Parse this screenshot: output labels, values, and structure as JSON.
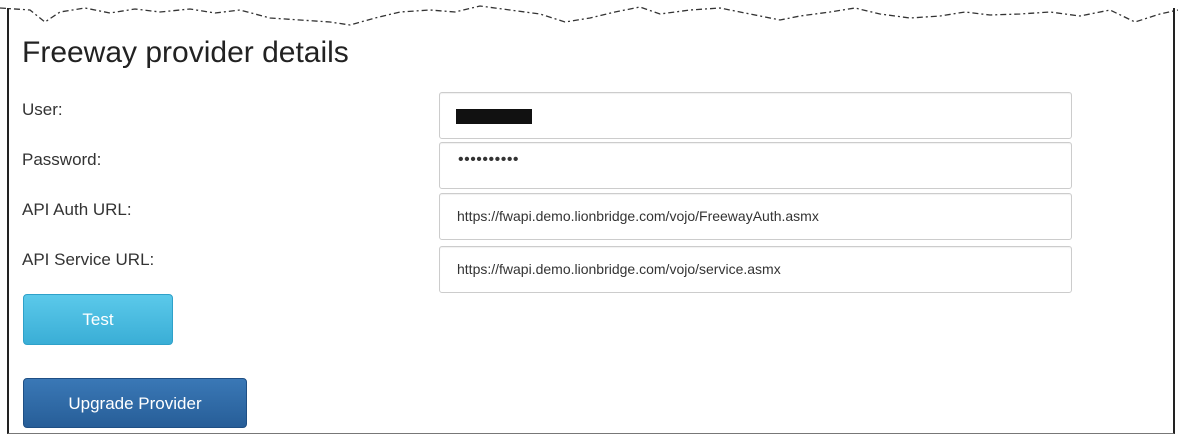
{
  "panel": {
    "title": "Freeway provider details"
  },
  "form": {
    "user": {
      "label": "User:"
    },
    "password": {
      "label": "Password:",
      "masked_value": "••••••••••"
    },
    "api_auth_url": {
      "label": "API Auth URL:",
      "value": "https://fwapi.demo.lionbridge.com/vojo/FreewayAuth.asmx"
    },
    "api_service_url": {
      "label": "API Service URL:",
      "value": "https://fwapi.demo.lionbridge.com/vojo/service.asmx"
    }
  },
  "buttons": {
    "test_label": "Test",
    "upgrade_label": "Upgrade Provider"
  },
  "colors": {
    "test_button": "#3aaed6",
    "upgrade_button": "#275e98",
    "field_border": "#cccccc"
  }
}
